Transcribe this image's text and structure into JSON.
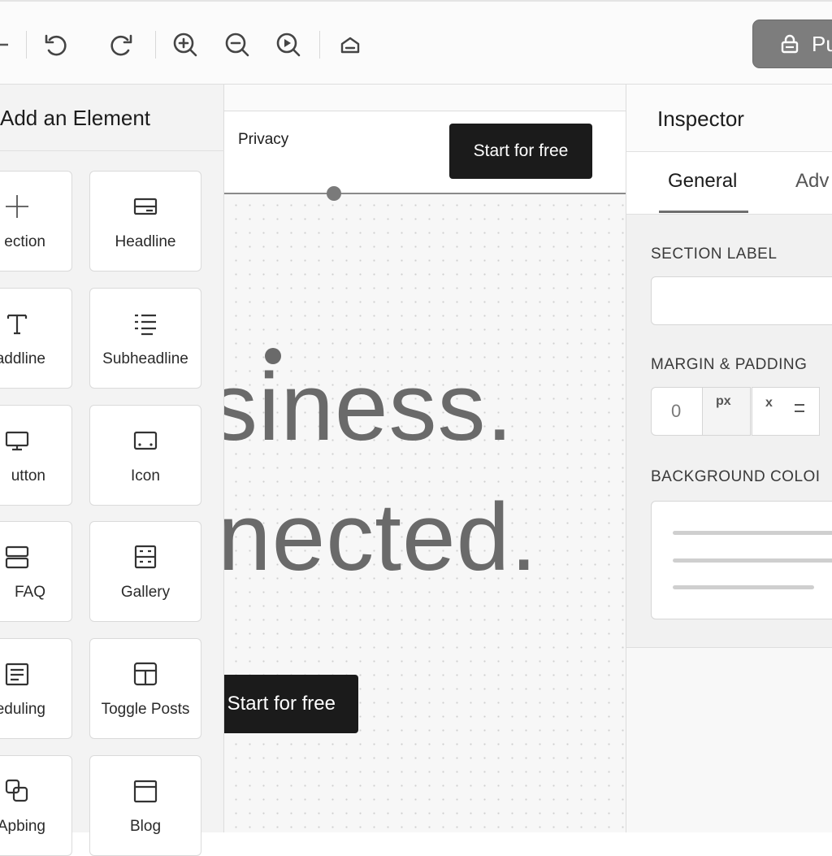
{
  "toolbar": {
    "publish_label": "Pu",
    "buttons": [
      "add-icon",
      "undo-icon",
      "redo-icon",
      "zoom-in-icon",
      "zoom-out-icon",
      "preview-icon",
      "home-icon"
    ],
    "publish_button_color": "#7d7d7d"
  },
  "left_panel": {
    "title": "Add an Element",
    "elements": [
      {
        "label": "ection",
        "icon": "plus-icon"
      },
      {
        "label": "Headline",
        "icon": "headline-icon"
      },
      {
        "label": "addline",
        "icon": "text-icon"
      },
      {
        "label": "Subheadline",
        "icon": "list-icon"
      },
      {
        "label": "utton",
        "icon": "monitor-icon"
      },
      {
        "label": "Icon",
        "icon": "icon-box-icon"
      },
      {
        "label": "FAQ",
        "icon": "faq-icon"
      },
      {
        "label": "Gallery",
        "icon": "gallery-icon"
      },
      {
        "label": "eduling",
        "icon": "document-icon"
      },
      {
        "label": "Toggle Posts",
        "icon": "layout-icon"
      },
      {
        "label": "Apbing",
        "icon": "shapes-icon"
      },
      {
        "label": "Blog",
        "icon": "blog-window-icon"
      }
    ]
  },
  "canvas": {
    "nav_link": "Privacy",
    "header_cta": "Start for free",
    "hero_line_1": "siness.",
    "hero_line_2": "nected.",
    "hero_cta": "Start for free",
    "cta_color": "#1b1b1b",
    "hero_text_color": "#6a6a6a"
  },
  "inspector": {
    "title": "Inspector",
    "tabs": [
      {
        "label": "General",
        "active": true
      },
      {
        "label": "Adv",
        "active": false
      }
    ],
    "section_label": "SECTION LABEL",
    "section_label_value": "",
    "margin_padding_label": "MARGIN & PADDING",
    "margin_value": "0",
    "margin_unit": "px",
    "margin_x": "x",
    "background_color_label": "BACKGROUND COLOI"
  }
}
